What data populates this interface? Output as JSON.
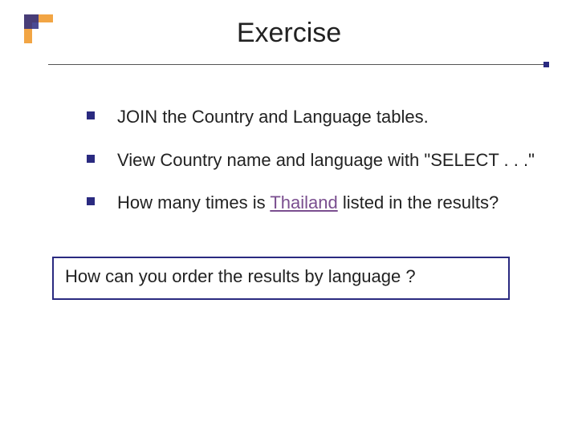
{
  "title": "Exercise",
  "bullets": [
    {
      "text": "JOIN the Country and Language tables."
    },
    {
      "text_pre": "View Country name and language with \"SELECT ",
      "text_post": "\"",
      "ellipsis": ". . ."
    },
    {
      "text_pre": "How many times is ",
      "highlight": "Thailand",
      "text_post": " listed in the results?"
    }
  ],
  "question_box": "How can you order the results by language ?"
}
